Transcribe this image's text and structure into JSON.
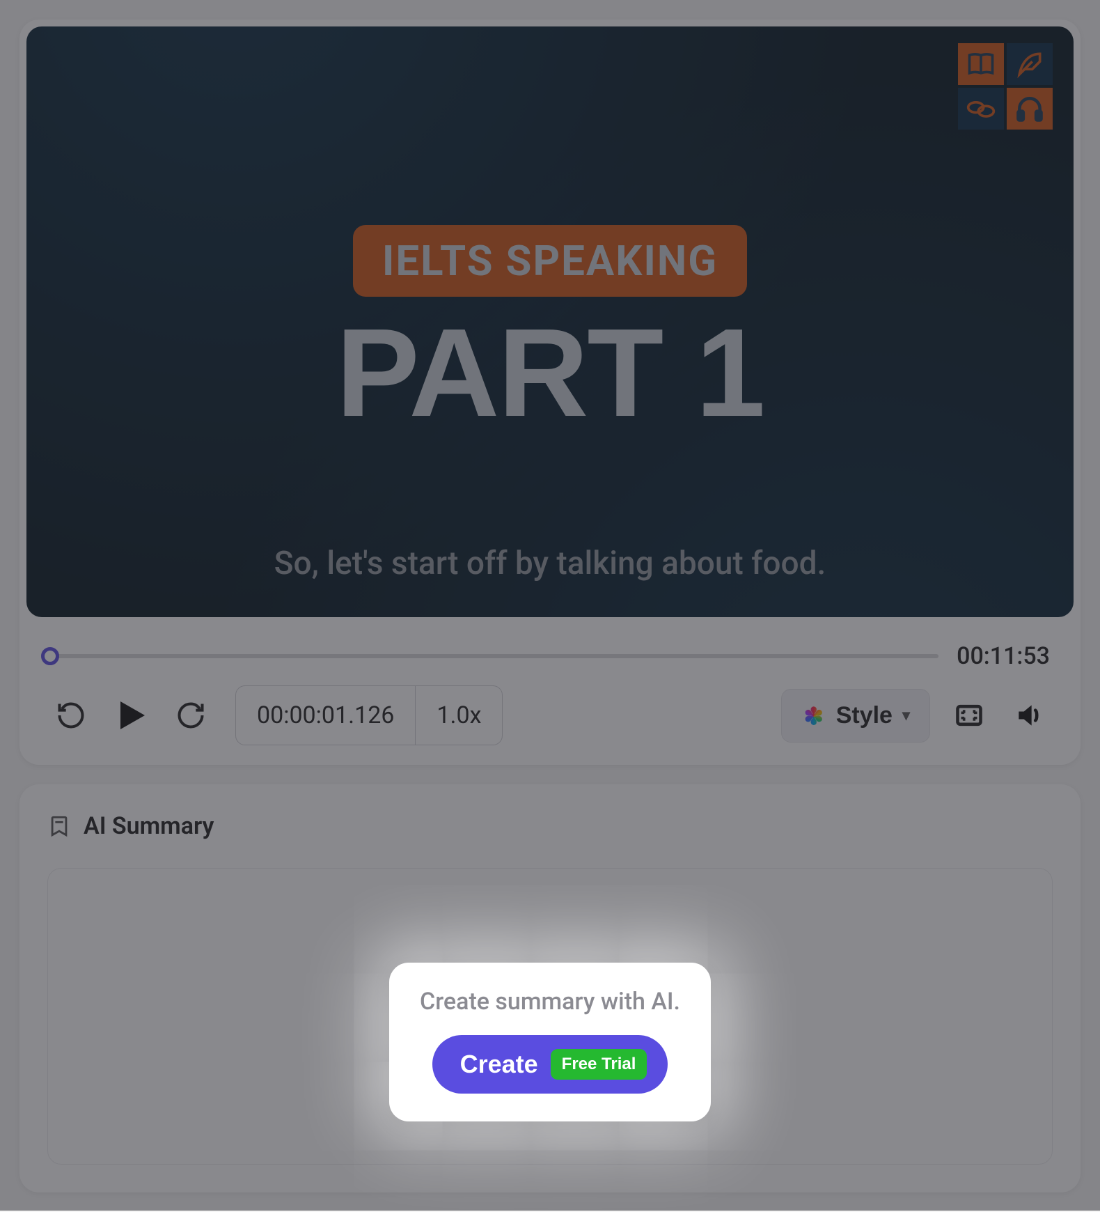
{
  "video": {
    "badge": "IELTS SPEAKING",
    "title": "PART 1",
    "caption": "So, let's start off by talking about food.",
    "skill_icons": [
      "book-icon",
      "feather-icon",
      "speech-icon",
      "headphones-icon"
    ]
  },
  "player": {
    "duration": "00:11:53",
    "current_time": "00:00:01.126",
    "speed": "1.0x",
    "style_label": "Style"
  },
  "summary": {
    "heading": "AI Summary"
  },
  "popover": {
    "prompt": "Create summary with AI.",
    "button_label": "Create",
    "badge": "Free Trial"
  },
  "colors": {
    "accent": "#5a4de0",
    "orange": "#cf5718",
    "green": "#25b930"
  }
}
